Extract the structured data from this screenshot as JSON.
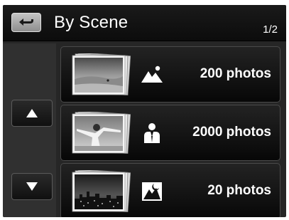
{
  "header": {
    "title": "By Scene",
    "page_indicator": "1/2"
  },
  "albums": [
    {
      "icon": "landscape-icon",
      "count_label": "200 photos"
    },
    {
      "icon": "person-icon",
      "count_label": "2000 photos"
    },
    {
      "icon": "night-scene-icon",
      "count_label": "20 photos"
    }
  ],
  "navigation": {
    "up_icon": "triangle-up-icon",
    "down_icon": "triangle-down-icon",
    "back_icon": "return-arrow-icon"
  }
}
